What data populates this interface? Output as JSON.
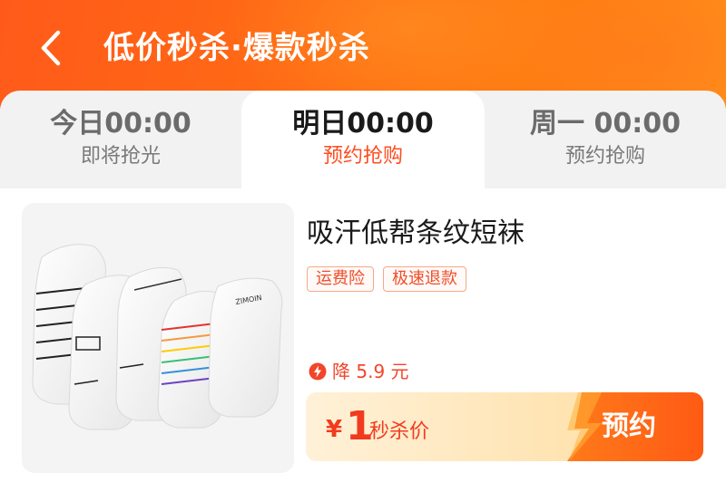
{
  "header": {
    "title": "低价秒杀·爆款秒杀",
    "back_icon": "chevron-left-icon"
  },
  "tabs": [
    {
      "time": "今日00:00",
      "status": "即将抢光",
      "active": false
    },
    {
      "time": "明日00:00",
      "status": "预约抢购",
      "active": true
    },
    {
      "time": "周一 00:00",
      "status": "预约抢购",
      "active": false
    }
  ],
  "product": {
    "title": "吸汗低帮条纹短袜",
    "tags": [
      "运费险",
      "极速退款"
    ],
    "discount_text": "降 5.9 元",
    "price_symbol": "¥",
    "price_value": "1",
    "price_label": "秒杀价",
    "reserve_button": "预约",
    "image_brand_text": "ZIMOIN"
  },
  "colors": {
    "header_start": "#ff5a1a",
    "header_end": "#ff8c1a",
    "accent_red": "#f23a1f",
    "button_orange": "#ff6a1a"
  }
}
